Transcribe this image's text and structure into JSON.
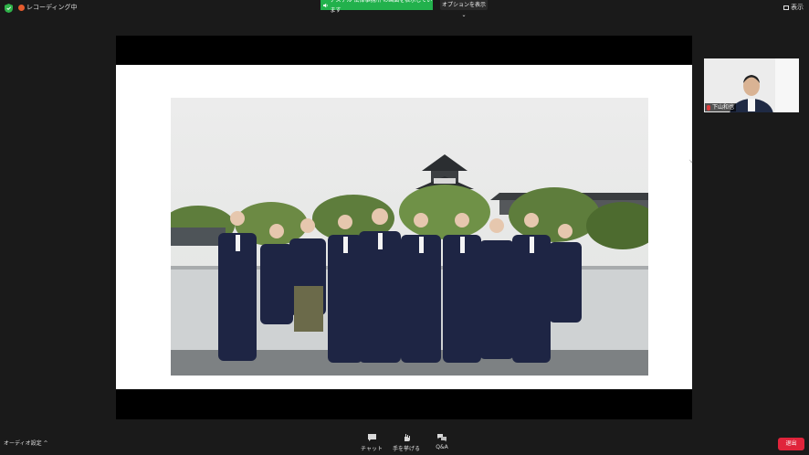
{
  "topbar": {
    "recording_label": "レコーディング中",
    "share_banner": "アステル 法律事務所 の画面を表示しています",
    "options_label": "オプションを表示 ⌄",
    "view_label": "表示"
  },
  "participant": {
    "name": "下山和也"
  },
  "bottombar": {
    "audio_label": "オーディオ設定 ^",
    "chat_label": "チャット",
    "raise_hand_label": "手を挙げる",
    "qa_label": "Q&A",
    "leave_label": "退出"
  },
  "colors": {
    "share_banner": "#22b14c",
    "leave_button": "#e0243b",
    "recording": "#e55b2d"
  },
  "icons": [
    "shield-icon",
    "record-icon",
    "speaker-icon",
    "grid-icon",
    "chat-icon",
    "hand-icon",
    "qa-icon",
    "mic-muted-icon"
  ]
}
